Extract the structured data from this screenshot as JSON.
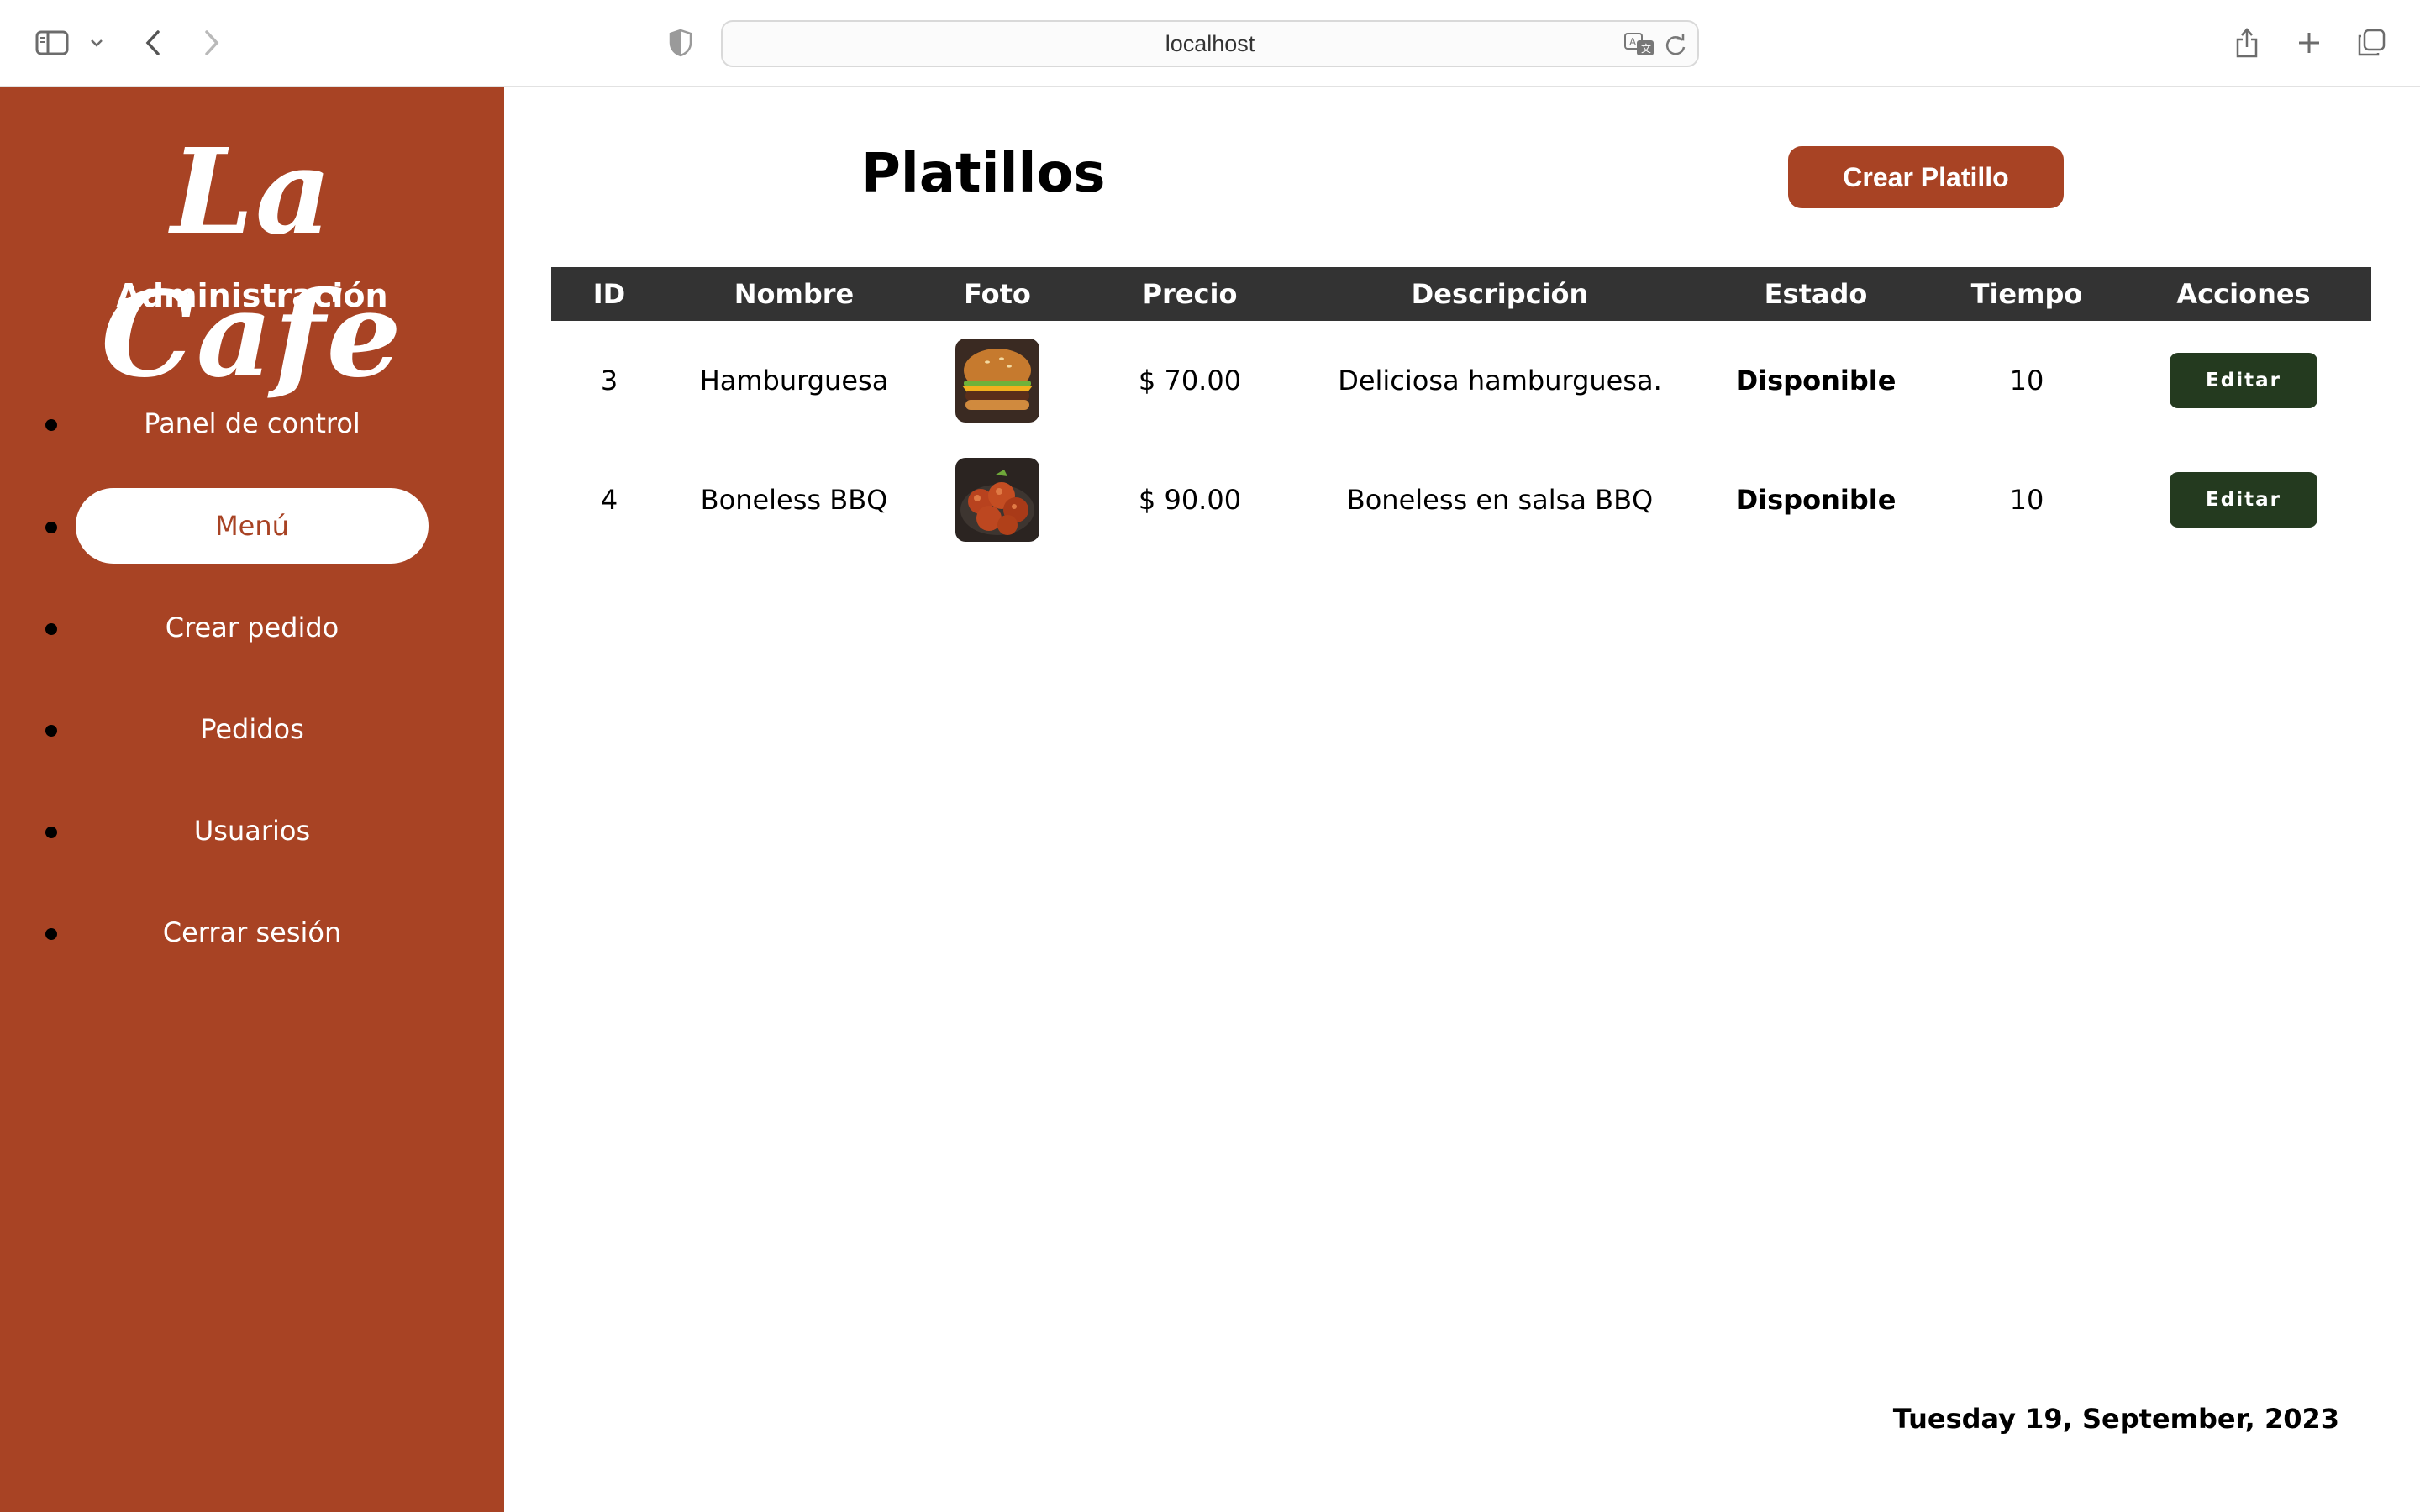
{
  "browser": {
    "url": "localhost",
    "icons": [
      "sidebar-icon",
      "chevron-down-icon",
      "back-icon",
      "forward-icon",
      "shield-icon",
      "translate-icon",
      "reload-icon",
      "share-icon",
      "new-tab-icon",
      "tabs-overview-icon"
    ]
  },
  "sidebar": {
    "logo": "La Cafe",
    "subtitle": "Administración",
    "items": [
      {
        "label": "Panel de control",
        "active": false
      },
      {
        "label": "Menú",
        "active": true
      },
      {
        "label": "Crear pedido",
        "active": false
      },
      {
        "label": "Pedidos",
        "active": false
      },
      {
        "label": "Usuarios",
        "active": false
      },
      {
        "label": "Cerrar sesión",
        "active": false
      }
    ]
  },
  "main": {
    "title": "Platillos",
    "create_button": "Crear Platillo",
    "table": {
      "headers": [
        "ID",
        "Nombre",
        "Foto",
        "Precio",
        "Descripción",
        "Estado",
        "Tiempo",
        "Acciones"
      ],
      "rows": [
        {
          "id": "3",
          "name": "Hamburguesa",
          "photo": "burger-photo",
          "price": "$ 70.00",
          "description": "Deliciosa hamburguesa.",
          "status": "Disponible",
          "time": "10",
          "action": "Editar"
        },
        {
          "id": "4",
          "name": "Boneless BBQ",
          "photo": "boneless-photo",
          "price": "$ 90.00",
          "description": "Boneless en salsa BBQ",
          "status": "Disponible",
          "time": "10",
          "action": "Editar"
        }
      ]
    },
    "date": "Tuesday 19, September, 2023"
  },
  "colors": {
    "sidebar": "#a84324",
    "header_row": "#333333",
    "status_available": "#2e7d32",
    "edit_button": "#243a1f"
  }
}
